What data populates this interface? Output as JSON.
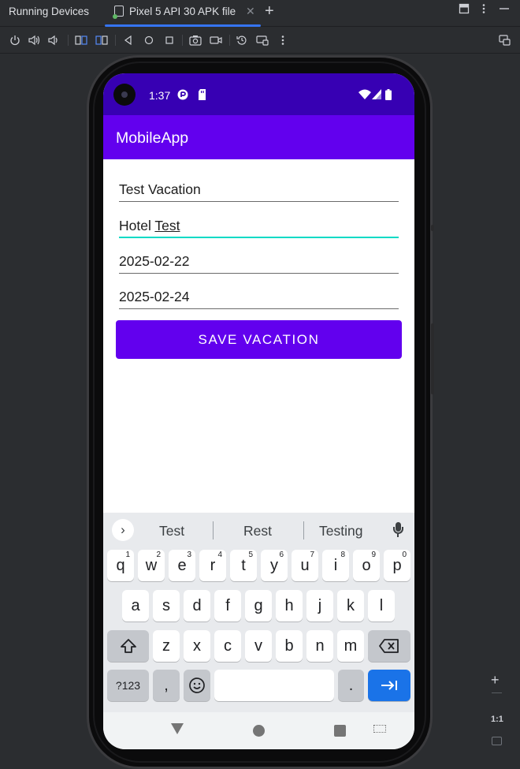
{
  "ide": {
    "tool_window_title": "Running Devices",
    "active_tab_label": "Pixel 5 API 30 APK file",
    "close_glyph": "✕",
    "add_tab_glyph": "+",
    "zoom_plus_glyph": "+",
    "zoom_ratio_label": "1:1",
    "accent_color": "#3574f0"
  },
  "status_bar": {
    "time": "1:37"
  },
  "app": {
    "title": "MobileApp",
    "primary_color": "#6200ee",
    "status_color": "#3700b3",
    "accent_color": "#03dac5"
  },
  "form": {
    "vacation_title": "Test Vacation",
    "hotel_prefix": "Hotel ",
    "hotel_composing": "Test",
    "start_date": "2025-02-22",
    "end_date": "2025-02-24",
    "save_label": "SAVE VACATION"
  },
  "keyboard": {
    "suggestions": [
      "Test",
      "Rest",
      "Testing"
    ],
    "row1": [
      {
        "key": "q",
        "hint": "1"
      },
      {
        "key": "w",
        "hint": "2"
      },
      {
        "key": "e",
        "hint": "3"
      },
      {
        "key": "r",
        "hint": "4"
      },
      {
        "key": "t",
        "hint": "5"
      },
      {
        "key": "y",
        "hint": "6"
      },
      {
        "key": "u",
        "hint": "7"
      },
      {
        "key": "i",
        "hint": "8"
      },
      {
        "key": "o",
        "hint": "9"
      },
      {
        "key": "p",
        "hint": "0"
      }
    ],
    "row2": [
      "a",
      "s",
      "d",
      "f",
      "g",
      "h",
      "j",
      "k",
      "l"
    ],
    "row3": [
      "z",
      "x",
      "c",
      "v",
      "b",
      "n",
      "m"
    ],
    "symbols_label": "?123",
    "comma_label": ",",
    "period_label": ".",
    "enter_color": "#1a73e8"
  }
}
